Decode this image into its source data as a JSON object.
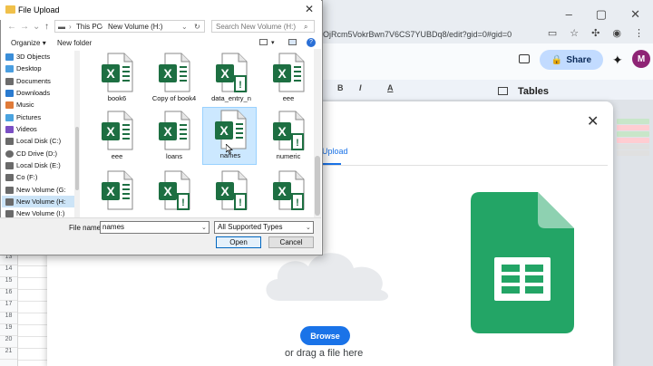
{
  "browser": {
    "url": "OjRcm5VokrBwn7V6CS7YUBDq8/edit?gid=0#gid=0",
    "window_controls": [
      "–",
      "▢",
      "✕"
    ]
  },
  "sheets": {
    "share_label": "Share",
    "avatar_letter": "M",
    "tables_title": "Tables",
    "toolbar_items": [
      "B",
      "I",
      "A"
    ],
    "row_numbers": [
      "13",
      "14",
      "15",
      "16",
      "17",
      "18",
      "19",
      "20",
      "21"
    ]
  },
  "modal": {
    "upload_tab": "Upload",
    "browse_label": "Browse",
    "drag_text": "or drag a file here"
  },
  "dialog": {
    "title": "File Upload",
    "path": [
      "This PC",
      "New Volume (H:)"
    ],
    "search_placeholder": "Search New Volume (H:)",
    "organize_label": "Organize",
    "new_folder_label": "New folder",
    "nav_items": [
      {
        "label": "3D Objects",
        "color": "#3b8ed8",
        "selected": false
      },
      {
        "label": "Desktop",
        "color": "#4a9ee0",
        "selected": false
      },
      {
        "label": "Documents",
        "color": "#6c6c6c",
        "selected": false
      },
      {
        "label": "Downloads",
        "color": "#2a7bd0",
        "selected": false
      },
      {
        "label": "Music",
        "color": "#e07b39",
        "selected": false
      },
      {
        "label": "Pictures",
        "color": "#4aa3df",
        "selected": false
      },
      {
        "label": "Videos",
        "color": "#7a4fc4",
        "selected": false
      },
      {
        "label": "Local Disk (C:)",
        "color": "#6a6a6a",
        "selected": false
      },
      {
        "label": "CD Drive (D:)",
        "color": "#6a6a6a",
        "selected": false
      },
      {
        "label": "Local Disk (E:)",
        "color": "#6a6a6a",
        "selected": false
      },
      {
        "label": "Co (F:)",
        "color": "#6a6a6a",
        "selected": false
      },
      {
        "label": "New Volume (G:",
        "color": "#6a6a6a",
        "selected": false
      },
      {
        "label": "New Volume (H:",
        "color": "#6a6a6a",
        "selected": true
      },
      {
        "label": "New Volume (I:)",
        "color": "#6a6a6a",
        "selected": false
      }
    ],
    "files": [
      {
        "label": "book6",
        "badge": false,
        "selected": false
      },
      {
        "label": "Copy of book4",
        "badge": false,
        "selected": false
      },
      {
        "label": "data_entry_n",
        "badge": true,
        "selected": false
      },
      {
        "label": "eee",
        "badge": false,
        "selected": false
      },
      {
        "label": "eee",
        "badge": false,
        "selected": false
      },
      {
        "label": "loans",
        "badge": false,
        "selected": false
      },
      {
        "label": "names",
        "badge": false,
        "selected": true
      },
      {
        "label": "numeric",
        "badge": true,
        "selected": false
      },
      {
        "label": "",
        "badge": false,
        "selected": false
      },
      {
        "label": "",
        "badge": true,
        "selected": false
      },
      {
        "label": "",
        "badge": true,
        "selected": false
      },
      {
        "label": "",
        "badge": true,
        "selected": false
      }
    ],
    "file_name_label": "File name:",
    "file_name_value": "names",
    "file_type_value": "All Supported Types",
    "open_label": "Open",
    "cancel_label": "Cancel"
  },
  "colors": {
    "excel_green": "#1d6f42",
    "sheets_green": "#23a566",
    "accent_blue": "#1a73e8",
    "selection": "#cce8ff"
  }
}
